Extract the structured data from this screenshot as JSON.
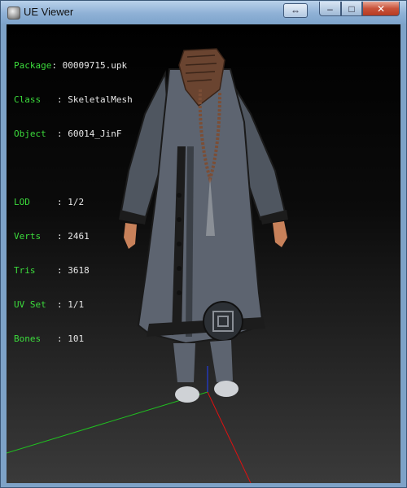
{
  "window": {
    "title": "UE Viewer",
    "buttons": {
      "extra_icon": "⇔",
      "minimize_icon": "–",
      "maximize_icon": "□",
      "close_icon": "✕"
    }
  },
  "info": {
    "package": {
      "label": "Package",
      "value": "00009715.upk"
    },
    "class": {
      "label": "Class",
      "value": "SkeletalMesh"
    },
    "object": {
      "label": "Object",
      "value": "60014_JinF"
    },
    "lod": {
      "label": "LOD",
      "value": "1/2"
    },
    "verts": {
      "label": "Verts",
      "value": "2461"
    },
    "tris": {
      "label": "Tris",
      "value": "3618"
    },
    "uvset": {
      "label": "UV Set",
      "value": "1/1"
    },
    "bones": {
      "label": "Bones",
      "value": "101"
    }
  },
  "colors": {
    "label_green": "#3cdc3c",
    "axis_x": "#e01010",
    "axis_y": "#20c020",
    "axis_z": "#2040ff",
    "robe": "#5d6470",
    "trim": "#1c1c1c",
    "beads": "#6a4430"
  }
}
